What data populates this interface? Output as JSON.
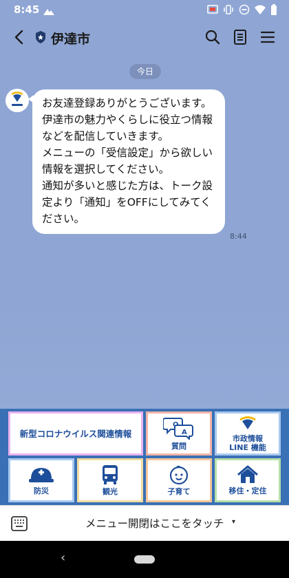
{
  "status_bar": {
    "time": "8:45"
  },
  "header": {
    "title": "伊達市"
  },
  "chat": {
    "date_label": "今日",
    "messages": [
      {
        "text": "お友達登録ありがとうございます。\n伊達市の魅力やくらしに役立つ情報などを配信していきます。\nメニューの「受信設定」から欲しい情報を選択してください。\n通知が多いと感じた方は、トーク設定より「通知」をOFFにしてみてください。",
        "time": "8:44"
      }
    ]
  },
  "rich_menu": {
    "tiles": [
      {
        "label": "新型コロナウイルス関連情報",
        "icon": "",
        "border": "#e9b3ef"
      },
      {
        "label": "質問",
        "icon": "qa-bubbles-icon",
        "border": "#f3b4a8"
      },
      {
        "label": "市政情報\nLINE 機能",
        "icon": "date-city-logo-icon",
        "border": "#a9c9ef"
      },
      {
        "label": "防災",
        "icon": "helmet-icon",
        "border": "#a9c9ef"
      },
      {
        "label": "観光",
        "icon": "bus-icon",
        "border": "#f1dca0"
      },
      {
        "label": "子育て",
        "icon": "baby-face-icon",
        "border": "#f5c79b"
      },
      {
        "label": "移住・定住",
        "icon": "house-icon",
        "border": "#b7e0a9"
      }
    ]
  },
  "menu_toggle": {
    "label": "メニュー開閉はここをタッチ",
    "arrow": "▾"
  },
  "colors": {
    "chat_background": "#8fa6d4",
    "menu_background": "#3a70b5",
    "menu_text": "#1d4e9a"
  }
}
